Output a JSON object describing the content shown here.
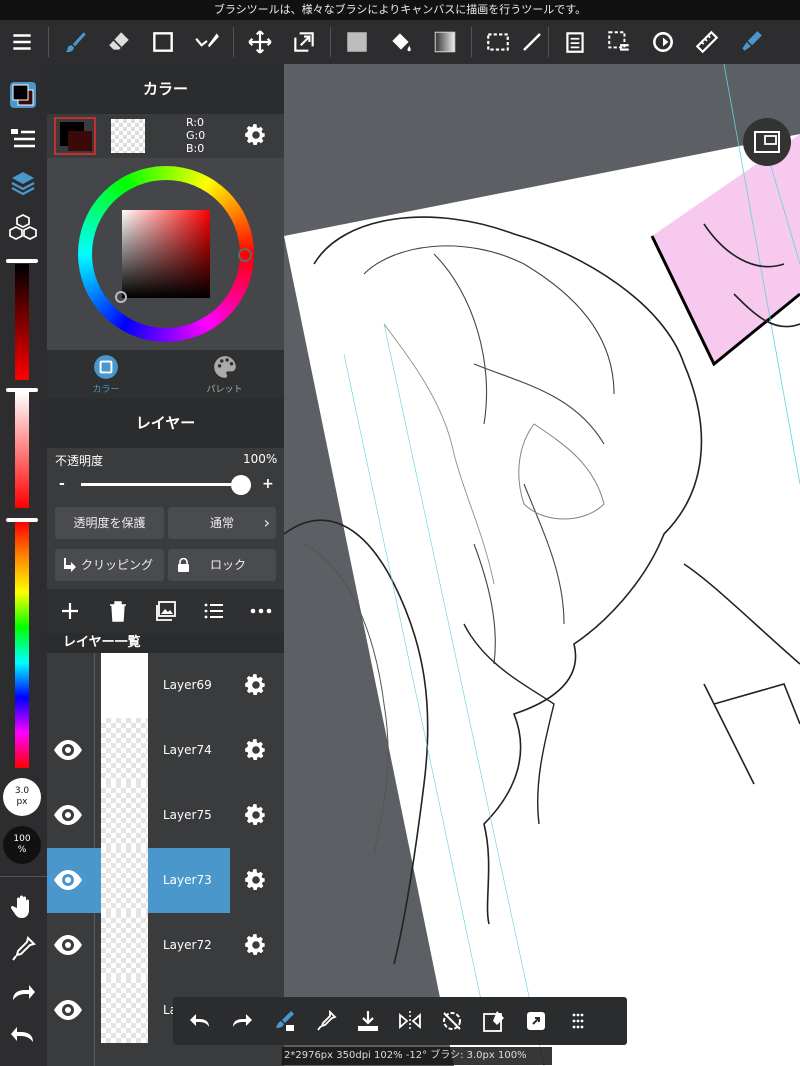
{
  "hint": "ブラシツールは、様々なブラシによりキャンバスに描画を行うツールです。",
  "color_panel": {
    "title": "カラー",
    "rgb": {
      "r": "R:0",
      "g": "G:0",
      "b": "B:0"
    },
    "tabs": [
      {
        "label": "カラー"
      },
      {
        "label": "パレット"
      }
    ],
    "main_color": "#000000",
    "accent": "#4a97cc"
  },
  "layer_panel": {
    "title": "レイヤー",
    "opacity_label": "不透明度",
    "opacity_value": "100%",
    "opacity": 1.0,
    "minus": "-",
    "plus": "+",
    "protect_alpha": "透明度を保護",
    "blend_mode": "通常",
    "clipping": "クリッピング",
    "lock": "ロック",
    "list_title": "レイヤー一覧",
    "layers": [
      {
        "name": "Layer69",
        "visible": false,
        "selected": false
      },
      {
        "name": "Layer74",
        "visible": true,
        "selected": false
      },
      {
        "name": "Layer75",
        "visible": true,
        "selected": false
      },
      {
        "name": "Layer73",
        "visible": true,
        "selected": true
      },
      {
        "name": "Layer72",
        "visible": true,
        "selected": false
      },
      {
        "name": "La",
        "visible": true,
        "selected": false
      }
    ]
  },
  "rail": {
    "brush_size": "3.0",
    "brush_size_unit": "px",
    "opacity_value": "100",
    "opacity_unit": "%"
  },
  "status": "2*2976px 350dpi 102% -12° ブラシ: 3.0px 100%"
}
